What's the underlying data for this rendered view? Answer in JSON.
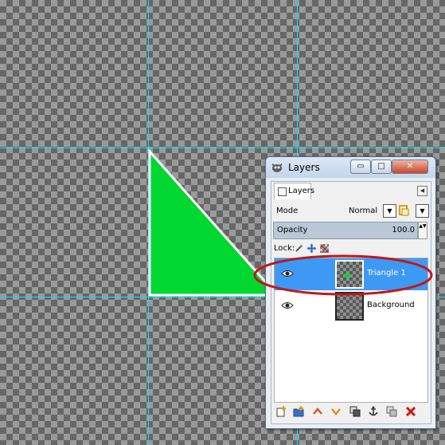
{
  "window": {
    "title": "Layers",
    "controls": {
      "minimize": "▭",
      "maximize": "□",
      "close": "✕"
    }
  },
  "panel": {
    "tab_label": "Layers",
    "tab_menu": "◀",
    "mode_label": "Mode",
    "mode_value": "Normal",
    "dropdown_arrow": "▼",
    "opacity_label": "Opacity",
    "opacity_value": "100.0",
    "spin": "▲▼",
    "lock_label": "Lock:"
  },
  "layers": [
    {
      "name": "Triangle 1",
      "selected": true,
      "visible": true
    },
    {
      "name": "Background",
      "selected": false,
      "visible": true
    }
  ],
  "bottom_icons": [
    "new-layer-icon",
    "new-group-icon",
    "raise-layer-icon",
    "lower-layer-icon",
    "duplicate-layer-icon",
    "anchor-layer-icon",
    "merge-layer-icon",
    "delete-layer-icon"
  ],
  "colors": {
    "triangle_fill": "#00d831",
    "guide": "#00e5ff",
    "selection": "#3e99f5",
    "annotation_ellipse": "#c0181b"
  }
}
